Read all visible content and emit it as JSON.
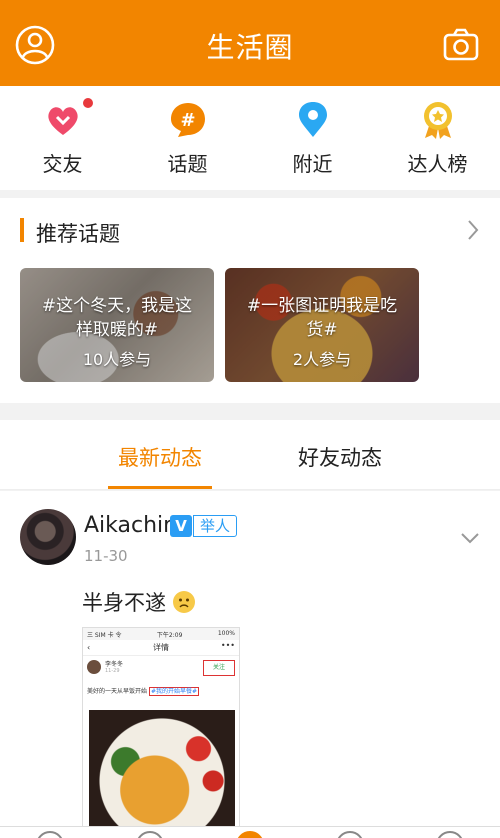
{
  "header": {
    "title": "生活圈"
  },
  "quick_nav": [
    {
      "label": "交友",
      "icon": "heart-icon",
      "color": "#ef4a6a"
    },
    {
      "label": "话题",
      "icon": "hashtag-icon",
      "color": "#f28500"
    },
    {
      "label": "附近",
      "icon": "location-pin-icon",
      "color": "#2aa8f2"
    },
    {
      "label": "达人榜",
      "icon": "medal-icon",
      "color": "#f2c12e"
    }
  ],
  "topics": {
    "title": "推荐话题",
    "cards": [
      {
        "title": "#这个冬天，我是这样取暖的#",
        "count": "10人参与"
      },
      {
        "title": "#一张图证明我是吃货#",
        "count": "2人参与"
      }
    ]
  },
  "feed_tabs": {
    "active": "最新动态",
    "inactive": "好友动态"
  },
  "post": {
    "username": "Aikachin",
    "badge_v": "V",
    "badge_text": "举人",
    "date": "11-30",
    "text": "半身不遂",
    "screenshot": {
      "status_left": "三 SIM 卡 令",
      "status_center": "下午2:09",
      "status_right": "100%",
      "nav_title": "详情",
      "user_name": "李冬冬",
      "user_date": "11-29",
      "follow": "关注",
      "line_text": "美好的一天从早饭开始",
      "line_tag": "#我的开始早餐#"
    }
  },
  "colors": {
    "accent": "#f28500",
    "blue": "#2a9df4"
  }
}
